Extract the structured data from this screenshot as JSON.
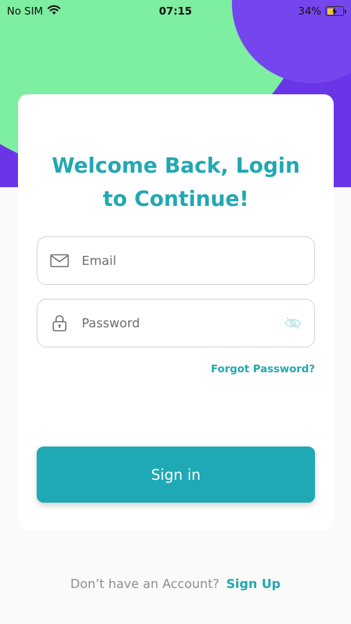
{
  "status_bar": {
    "carrier": "No SIM",
    "time": "07:15",
    "battery_percent": "34%",
    "battery_level": 0.34
  },
  "login": {
    "title_line1": "Welcome Back, Login",
    "title_line2": "to Continue!",
    "email_placeholder": "Email",
    "password_placeholder": "Password",
    "forgot_label": "Forgot Password?",
    "signin_label": "Sign in",
    "signup_prompt": "Don’t have an Account?",
    "signup_label": "Sign Up"
  },
  "colors": {
    "accent": "#22a8b3",
    "button": "#1fa9b4",
    "hero_purple": "#6a35e6",
    "hero_green": "#7eeea0"
  },
  "icons": [
    "wifi-icon",
    "battery-icon",
    "mail-icon",
    "lock-icon",
    "eye-off-icon"
  ]
}
